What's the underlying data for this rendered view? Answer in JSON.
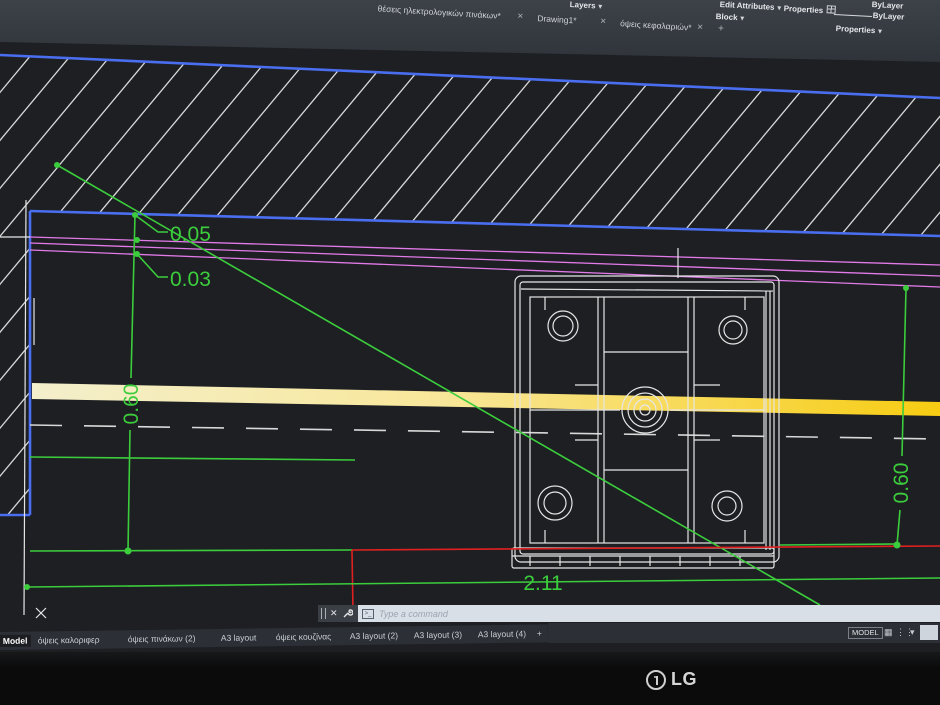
{
  "file_tabs": [
    {
      "label": "θέσεις ηλεκτρολογικών πινάκων*",
      "close": "×"
    },
    {
      "label": "Drawing1*",
      "close": "×"
    },
    {
      "label": "όψεις κεφαλαριών*",
      "close": "×"
    }
  ],
  "new_tab": "+",
  "ribbon": {
    "layers": "Layers",
    "edit_attributes": "Edit Attributes",
    "block": "Block",
    "properties": "Properties",
    "bylayer_color": "ByLayer",
    "bylayer_linetype": "ByLayer",
    "properties_panel": "Properties"
  },
  "dimensions": {
    "offset_top": "0.05",
    "offset_second": "0.03",
    "height_left": "0.60",
    "height_right": "0.60",
    "width_bottom": "2.11"
  },
  "command_line": {
    "close": "✕",
    "prompt": ">_",
    "placeholder": "Type a command"
  },
  "layout_tabs": [
    "Model",
    "όψεις καλοριφερ",
    "όψεις πινάκων (2)",
    "A3 layout",
    "όψεις κουζίνας",
    "A3 layout (2)",
    "A3 layout (3)",
    "A3 layout (4)"
  ],
  "layout_new_tab": "+",
  "status_bar": {
    "space": "MODEL",
    "grid": "▦",
    "snap": "⋮⋮",
    "menu": "▾"
  },
  "monitor": {
    "brand": "LG"
  },
  "icons": {
    "dropdown": "chevron-down-icon",
    "tab_close": "close-icon",
    "command_customize": "wrench-icon",
    "ucs": "ucs-x-icon",
    "grid": "grid-icon",
    "brand_logo": "lg-logo-icon"
  },
  "colors": {
    "drawing_background": "#1d1f23",
    "layer_blue": "#4a6ef0",
    "layer_pink": "#e27ae8",
    "dimension_green": "#3ccd3c",
    "section_red": "#e02020",
    "wall_yellow": "#f7cc12",
    "ui_panel": "#2c3036"
  }
}
